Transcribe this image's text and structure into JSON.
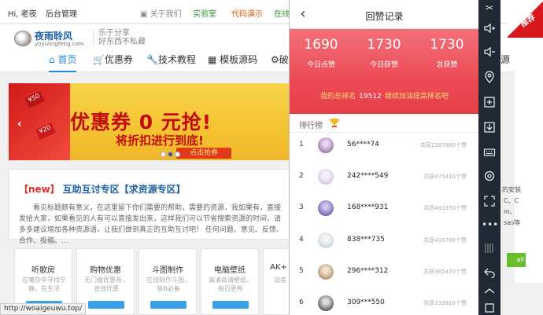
{
  "site": {
    "topbar": {
      "greeting": "Hi, 老夜",
      "admin": "后台管理",
      "about": "关于我们",
      "lab": "实验室",
      "code_demo": "代码演示",
      "online": "在线"
    },
    "logo": {
      "main": "夜雨聆风",
      "sub": "yoyulingfeng.com"
    },
    "slogan": [
      "乐于分享",
      "好东西不私藏"
    ],
    "nav": [
      {
        "label": "首页",
        "icon": "home-icon",
        "active": true
      },
      {
        "label": "优惠券",
        "icon": "cart-icon",
        "active": false
      },
      {
        "label": "技术教程",
        "icon": "wrench-icon",
        "active": false
      },
      {
        "label": "模板源码",
        "icon": "layout-icon",
        "active": false
      },
      {
        "label": "破",
        "icon": "gear-icon",
        "active": false
      }
    ],
    "nav_right": "源",
    "banner": {
      "title": "优惠券 0 元抢!",
      "subtitle": "将折扣进行到底!",
      "button": "点击抢券",
      "tag1": "¥50",
      "tag2": "¥20"
    },
    "notice": {
      "tag": "【new】",
      "title": "互助互讨专区【求资源专区】",
      "body": "看见标题颇有意义，在这里留下你们需要的帮助，需要的资源，我如果有，直接发给大家，如果看见的人有可以直接发出来，这样我们可以节省搜索资源的时间，请多多建议增加各种资源语，让我们做到真正的互助互讨吧！ 任何问题、意见、反馈、合作、投稿、..."
    },
    "cards": [
      {
        "title": "听歌房",
        "desc": "在嘈杂中寻找宁静，在生活"
      },
      {
        "title": "购物优惠",
        "desc": "无门槛优惠券，省钱优惠"
      },
      {
        "title": "斗图制作",
        "desc": "在线制作斗图，装B必备"
      },
      {
        "title": "电脑壁纸",
        "desc": "高清高清壁纸，每日更新"
      },
      {
        "title": "AK+",
        "desc": "误差"
      }
    ],
    "status_url": "http://woaigeuwu.top/",
    "right_texts": [
      "的安装",
      "C、C",
      "m、",
      "sas等"
    ],
    "right_button": "all",
    "corner_badge": "推荐"
  },
  "phone": {
    "title": "回赞记录",
    "stats": [
      {
        "value": "1690",
        "label": "今日点赞"
      },
      {
        "value": "1730",
        "label": "今日获赞"
      },
      {
        "value": "1730",
        "label": "总获赞"
      }
    ],
    "rank_prefix": "我的总排名",
    "rank_value": "19512",
    "rank_suffix": "继续加油提高排名吧",
    "list_label": "排行榜",
    "rows": [
      {
        "rank": "1",
        "name": "56****74",
        "total": "共获2287880个赞",
        "color": "#a77fb0"
      },
      {
        "rank": "2",
        "name": "242****549",
        "total": "共获475410个赞",
        "color": "#d7c6e3"
      },
      {
        "rank": "3",
        "name": "168****931",
        "total": "共获463350个赞",
        "color": "#7b6bb0"
      },
      {
        "rank": "4",
        "name": "838***735",
        "total": "共获418780个赞",
        "color": "#c9d4dc"
      },
      {
        "rank": "5",
        "name": "296****312",
        "total": "共获385470个赞",
        "color": "#b69a7e"
      },
      {
        "rank": "6",
        "name": "309***550",
        "total": "共获333910个赞",
        "color": "#666666"
      }
    ]
  },
  "toolbar": {
    "buttons": [
      "scissors-icon",
      "volume-up-icon",
      "volume-down-icon",
      "location-icon",
      "add-app-icon",
      "apk-install-icon",
      "keyboard-icon",
      "settings-icon",
      "fullscreen-icon",
      "more-icon",
      "back-icon",
      "home-icon",
      "recent-apps-icon"
    ]
  }
}
